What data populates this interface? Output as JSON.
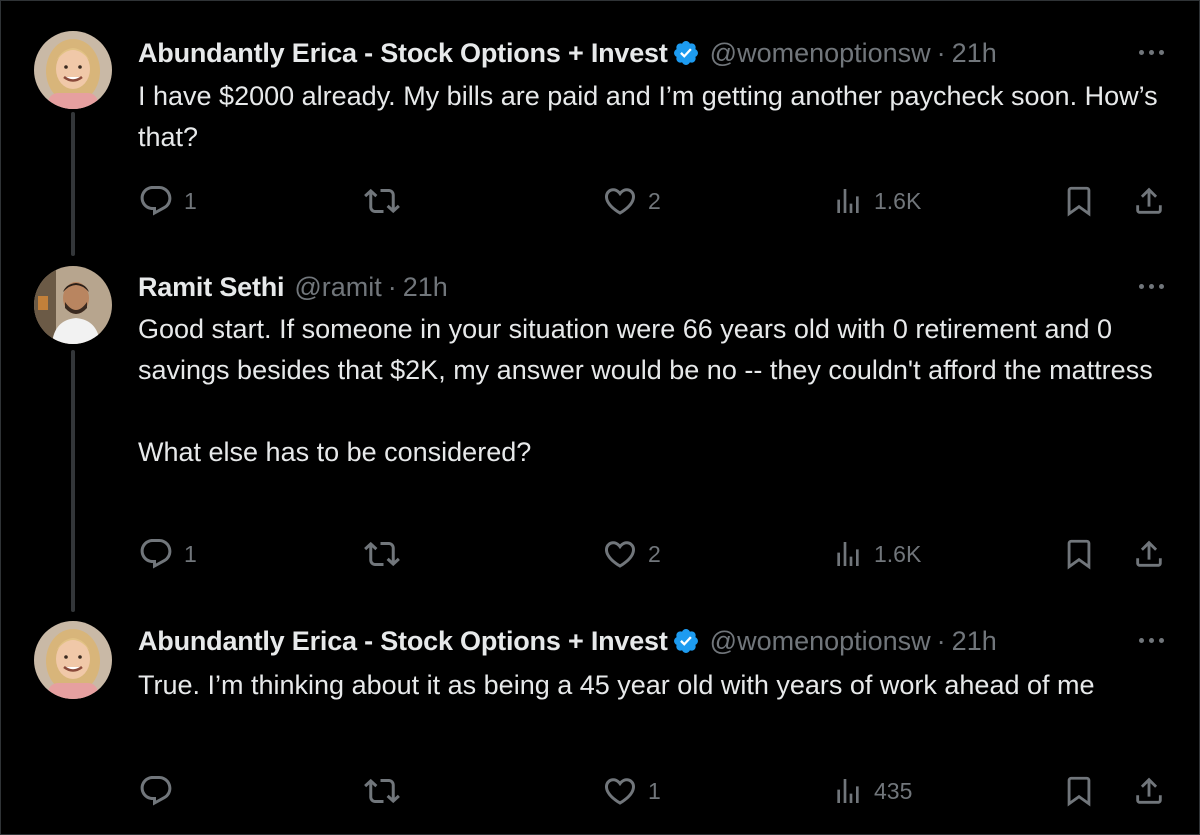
{
  "tweets": [
    {
      "name": "Abundantly Erica - Stock Options + Invest",
      "handle": "@womenoptionsw",
      "dot": "·",
      "time": "21h",
      "verified": true,
      "text": "I have $2000 already. My bills are paid and I’m getting another paycheck soon. How’s that?",
      "replies": "1",
      "retweets": "",
      "likes": "2",
      "views": "1.6K",
      "avatar_icon": "avatar-blonde-woman"
    },
    {
      "name": "Ramit Sethi",
      "handle": "@ramit",
      "dot": "·",
      "time": "21h",
      "verified": false,
      "text": "Good start. If someone in your situation were 66 years old with 0 retirement and 0 savings besides that $2K, my answer would be no -- they couldn't afford the mattress\n\nWhat else has to be considered?",
      "replies": "1",
      "retweets": "",
      "likes": "2",
      "views": "1.6K",
      "avatar_icon": "avatar-man-beard"
    },
    {
      "name": "Abundantly Erica - Stock Options + Invest",
      "handle": "@womenoptionsw",
      "dot": "·",
      "time": "21h",
      "verified": true,
      "text": "True. I’m thinking about it as being a 45 year old with years of work ahead of me",
      "replies": "",
      "retweets": "",
      "likes": "1",
      "views": "435",
      "avatar_icon": "avatar-blonde-woman"
    }
  ],
  "icons": {
    "reply": "reply-icon",
    "retweet": "retweet-icon",
    "like": "heart-icon",
    "views": "views-icon",
    "bookmark": "bookmark-icon",
    "share": "share-icon",
    "more": "more-icon",
    "verified": "verified-badge-icon"
  },
  "colors": {
    "background": "#000000",
    "text": "#e7e9ea",
    "muted": "#71767b",
    "verified": "#1d9bf0",
    "thread_line": "#333639"
  }
}
